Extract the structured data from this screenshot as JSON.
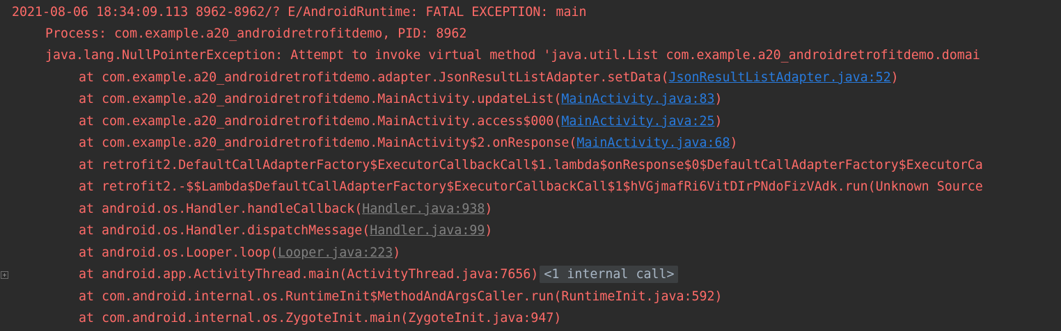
{
  "log": {
    "header": "2021-08-06 18:34:09.113 8962-8962/? E/AndroidRuntime: FATAL EXCEPTION: main",
    "process": "Process: com.example.a20_androidretrofitdemo, PID: 8962",
    "exception": "java.lang.NullPointerException: Attempt to invoke virtual method 'java.util.List com.example.a20_androidretrofitdemo.domai",
    "frames": [
      {
        "prefix": "at com.example.a20_androidretrofitdemo.adapter.JsonResultListAdapter.setData(",
        "link": "JsonResultListAdapter.java:52",
        "suffix": ")"
      },
      {
        "prefix": "at com.example.a20_androidretrofitdemo.MainActivity.updateList(",
        "link": "MainActivity.java:83",
        "suffix": ")"
      },
      {
        "prefix": "at com.example.a20_androidretrofitdemo.MainActivity.access$000(",
        "link": "MainActivity.java:25",
        "suffix": ")"
      },
      {
        "prefix": "at com.example.a20_androidretrofitdemo.MainActivity$2.onResponse(",
        "link": "MainActivity.java:68",
        "suffix": ")"
      },
      {
        "text": "at retrofit2.DefaultCallAdapterFactory$ExecutorCallbackCall$1.lambda$onResponse$0$DefaultCallAdapterFactory$ExecutorCa"
      },
      {
        "text": "at retrofit2.-$$Lambda$DefaultCallAdapterFactory$ExecutorCallbackCall$1$hVGjmafRi6VitDIrPNdoFizVAdk.run(Unknown Source"
      },
      {
        "prefix": "at android.os.Handler.handleCallback(",
        "link": "Handler.java:938",
        "suffix": ")"
      },
      {
        "prefix": "at android.os.Handler.dispatchMessage(",
        "link": "Handler.java:99",
        "suffix": ")"
      },
      {
        "prefix": "at android.os.Looper.loop(",
        "link": "Looper.java:223",
        "suffix": ")"
      },
      {
        "text": "at android.app.ActivityThread.main(ActivityThread.java:7656)",
        "badge": "<1 internal call>"
      },
      {
        "text": "at com.android.internal.os.RuntimeInit$MethodAndArgsCaller.run(RuntimeInit.java:592)"
      },
      {
        "text": "at com.android.internal.os.ZygoteInit.main(ZygoteInit.java:947)"
      }
    ]
  },
  "colors": {
    "background": "#2b2b2b",
    "error_text": "#ff6b68",
    "app_link": "#287bde",
    "system_link": "#808080",
    "badge_bg": "#3c3f41",
    "badge_text": "#a9b7c6"
  },
  "icons": {
    "expand": "expand-icon"
  }
}
